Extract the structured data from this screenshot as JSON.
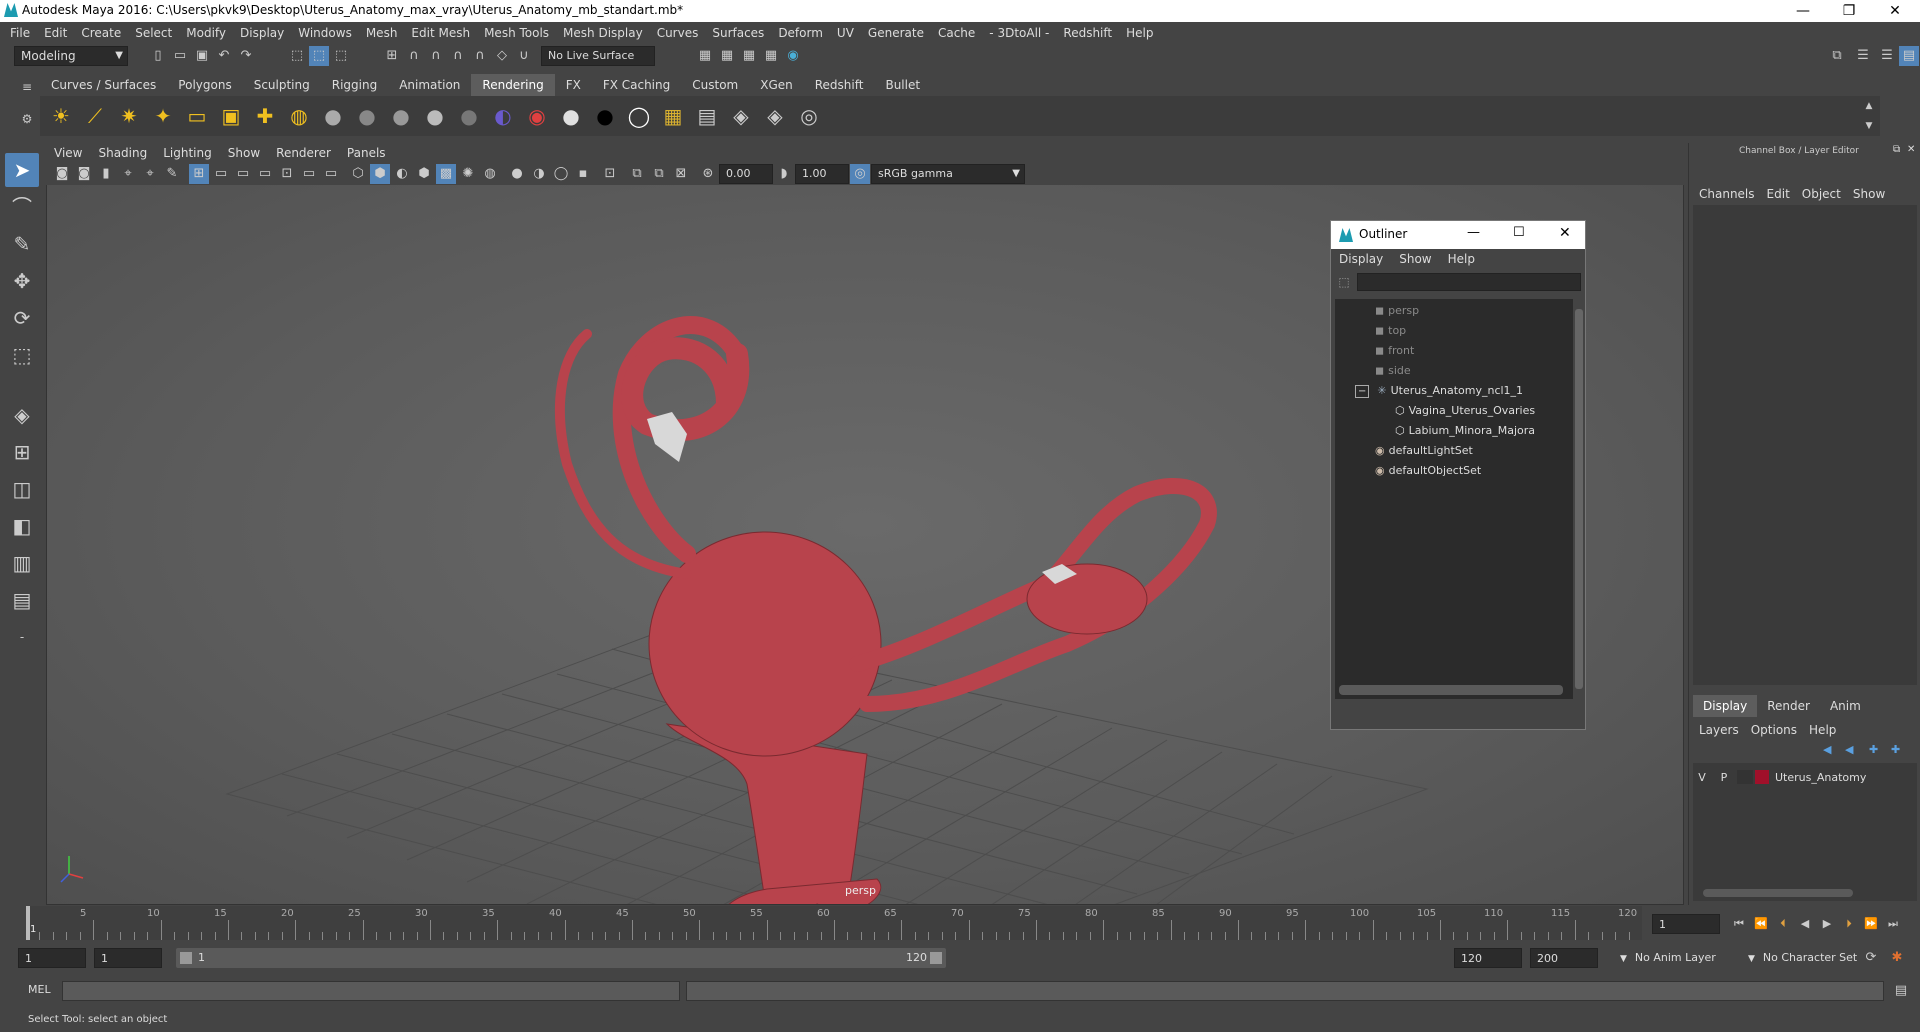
{
  "window": {
    "title": "Autodesk Maya 2016: C:\\Users\\pkvk9\\Desktop\\Uterus_Anatomy_max_vray\\Uterus_Anatomy_mb_standart.mb*",
    "minimize": "—",
    "maximize": "❐",
    "close": "✕"
  },
  "menubar": [
    "File",
    "Edit",
    "Create",
    "Select",
    "Modify",
    "Display",
    "Windows",
    "Mesh",
    "Edit Mesh",
    "Mesh Tools",
    "Mesh Display",
    "Curves",
    "Surfaces",
    "Deform",
    "UV",
    "Generate",
    "Cache",
    "- 3DtoAll -",
    "Redshift",
    "Help"
  ],
  "statusline": {
    "mode": "Modeling",
    "live_surface": "No Live Surface"
  },
  "shelf_tabs": [
    "Curves / Surfaces",
    "Polygons",
    "Sculpting",
    "Rigging",
    "Animation",
    "Rendering",
    "FX",
    "FX Caching",
    "Custom",
    "XGen",
    "Redshift",
    "Bullet"
  ],
  "active_shelf": "Rendering",
  "viewport": {
    "menu": [
      "View",
      "Shading",
      "Lighting",
      "Show",
      "Renderer",
      "Panels"
    ],
    "exposure": "0.00",
    "gamma": "1.00",
    "colorspace": "sRGB gamma",
    "camera_label": "persp"
  },
  "outliner": {
    "title": "Outliner",
    "menu": [
      "Display",
      "Show",
      "Help"
    ],
    "items": [
      {
        "label": "persp",
        "type": "camera",
        "dim": true
      },
      {
        "label": "top",
        "type": "camera",
        "dim": true
      },
      {
        "label": "front",
        "type": "camera",
        "dim": true
      },
      {
        "label": "side",
        "type": "camera",
        "dim": true
      },
      {
        "label": "Uterus_Anatomy_ncl1_1",
        "type": "group",
        "expanded": true
      },
      {
        "label": "Vagina_Uterus_Ovaries",
        "type": "mesh",
        "child": true
      },
      {
        "label": "Labium_Minora_Majora",
        "type": "mesh",
        "child": true
      },
      {
        "label": "defaultLightSet",
        "type": "set"
      },
      {
        "label": "defaultObjectSet",
        "type": "set"
      }
    ]
  },
  "channelbox": {
    "title": "Channel Box / Layer Editor",
    "menu": [
      "Channels",
      "Edit",
      "Object",
      "Show"
    ],
    "layer_tabs": [
      "Display",
      "Render",
      "Anim"
    ],
    "layer_menu": [
      "Layers",
      "Options",
      "Help"
    ],
    "layer": {
      "v": "V",
      "p": "P",
      "name": "Uterus_Anatomy",
      "color": "#a0102a"
    }
  },
  "timeline": {
    "ticks": [
      "5",
      "10",
      "15",
      "20",
      "25",
      "30",
      "35",
      "40",
      "45",
      "50",
      "55",
      "60",
      "65",
      "70",
      "75",
      "80",
      "85",
      "90",
      "95",
      "100",
      "105",
      "110",
      "115",
      "120"
    ],
    "current_marker": "1",
    "current_frame": "1"
  },
  "range": {
    "start": "1",
    "playback_start": "1",
    "slider_start": "1",
    "slider_end": "120",
    "playback_end": "120",
    "end": "200",
    "anim_layer": "No Anim Layer",
    "char_set": "No Character Set"
  },
  "cmdline": {
    "lang": "MEL"
  },
  "helpline": {
    "text": "Select Tool: select an object"
  },
  "colors": {
    "accent": "#5284b8",
    "bg": "#444444",
    "field": "#2b2b2b",
    "model": "#b8434c"
  }
}
